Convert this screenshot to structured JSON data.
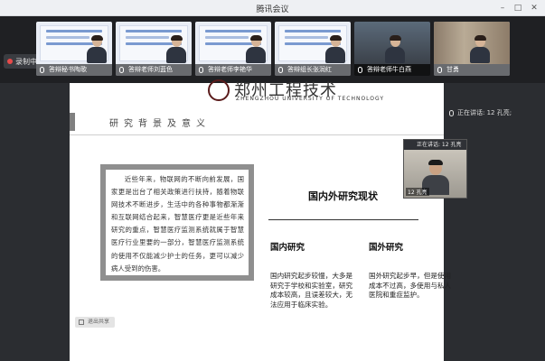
{
  "window": {
    "title": "腾讯会议",
    "controls": [
      "minimize",
      "maximize",
      "close"
    ]
  },
  "record": {
    "label": "录制中"
  },
  "participants": [
    {
      "name": "答辩秘书陶歌",
      "kind": "slide"
    },
    {
      "name": "答辩老师刘蓝色",
      "kind": "slide"
    },
    {
      "name": "答辩老师李艳华",
      "kind": "slide"
    },
    {
      "name": "答辩组长张润红",
      "kind": "slide"
    },
    {
      "name": "答辩老师牛白燕",
      "kind": "camera"
    },
    {
      "name": "甘勇",
      "kind": "camera"
    }
  ],
  "speaking": {
    "label": "正在讲话: 12 孔亮;"
  },
  "slide": {
    "logo_cn": "郑州工程技术",
    "logo_en": "ZHENGZHOU UNIVERSITY OF TECHNOLOGY",
    "section_title": "研究背景及意义",
    "quote": "近些年来，物联网的不断向前发展，国家更是出台了相关政策进行扶持，随着物联网技术不断进步，生活中的各种事物都渐渐和互联网结合起来，智慧医疗更是近些年来研究的重点，智慧医疗监测系统就属于智慧医疗行业里要的一部分，智慧医疗监测系统的使用不仅能减少护士的任务，更可以减少病人受到的伤害。",
    "main_heading": "国内外研究现状",
    "domestic": {
      "title": "国内研究",
      "text": "国内研究起步较慢，大多是研究于学校和实验室，研究成本较高，且误差较大，无法应用于临床实验。"
    },
    "foreign": {
      "title": "国外研究",
      "text": "国外研究起步早，但是使用成本不过高，多使用与私人医院和重症监护。"
    }
  },
  "self_view": {
    "header": "正在讲话: 12 孔亮",
    "name": "12 孔亮"
  },
  "nav_pill": {
    "label": "退出共享"
  },
  "colors": {
    "background": "#2b2d31",
    "strip": "#1f2023",
    "slide": "#ffffff",
    "quote_frame": "#8f8f8f",
    "record_dot": "#e84a4a"
  }
}
